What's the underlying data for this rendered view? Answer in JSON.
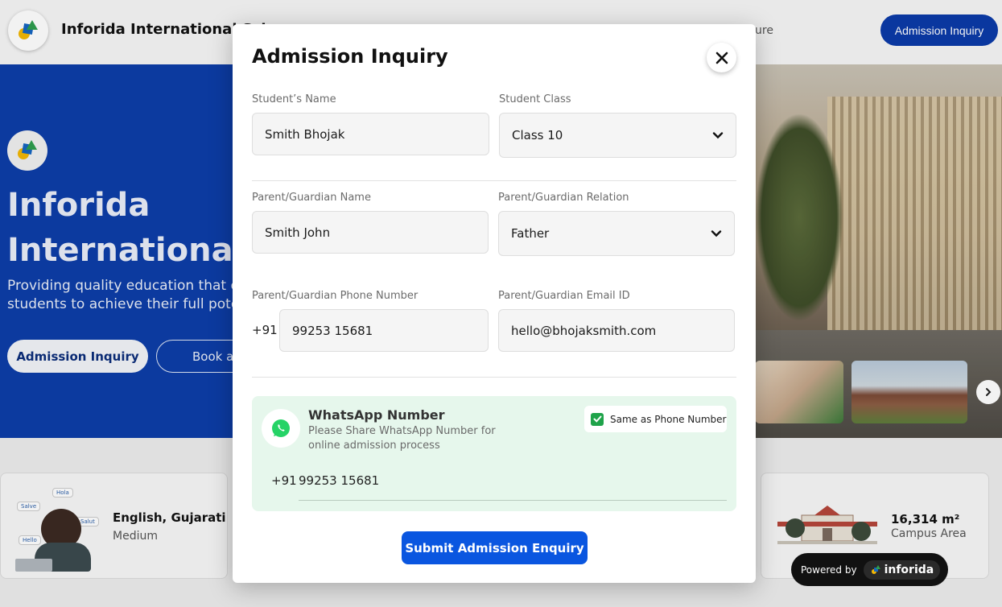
{
  "header": {
    "school_name": "Inforida International Sch",
    "nav_partial": "ure",
    "cta_label": "Admission Inquiry"
  },
  "hero": {
    "title_line1": "Inforida",
    "title_line2": "International S",
    "subtitle_line1": "Providing quality education that e",
    "subtitle_line2": "students to achieve their full pote",
    "primary_button": "Admission Inquiry",
    "secondary_button": "Book a"
  },
  "stats": {
    "language": {
      "value": "English, Gujarati",
      "label": "Medium"
    },
    "campus": {
      "value": "16,314 m²",
      "label": "Campus Area"
    },
    "bubbles": [
      "Hola",
      "Salve",
      "Salut",
      "Hello"
    ]
  },
  "modal": {
    "title": "Admission Inquiry",
    "fields": {
      "student_name": {
        "label": "Student’s Name",
        "value": "Smith Bhojak"
      },
      "student_class": {
        "label": "Student Class",
        "value": "Class 10"
      },
      "guardian_name": {
        "label": "Parent/Guardian Name",
        "value": "Smith John"
      },
      "guardian_relation": {
        "label": "Parent/Guardian Relation",
        "value": "Father"
      },
      "guardian_phone": {
        "label": "Parent/Guardian Phone Number",
        "prefix": "+91",
        "value": "99253 15681"
      },
      "guardian_email": {
        "label": "Parent/Guardian Email ID",
        "value": "hello@bhojaksmith.com"
      }
    },
    "whatsapp": {
      "title": "WhatsApp Number",
      "description": "Please Share WhatsApp Number for online admission process",
      "same_as_phone_label": "Same as Phone Number",
      "same_as_phone_checked": true,
      "prefix": "+91",
      "value": "99253 15681"
    },
    "submit_label": "Submit Admission Enquiry"
  },
  "powered_by": {
    "label": "Powered by",
    "brand": "inforida"
  },
  "colors": {
    "brand_blue": "#0b3aa8",
    "submit_blue": "#0a56e0",
    "whatsapp_green": "#25d366",
    "whatsapp_bg": "#e6f7ec"
  }
}
